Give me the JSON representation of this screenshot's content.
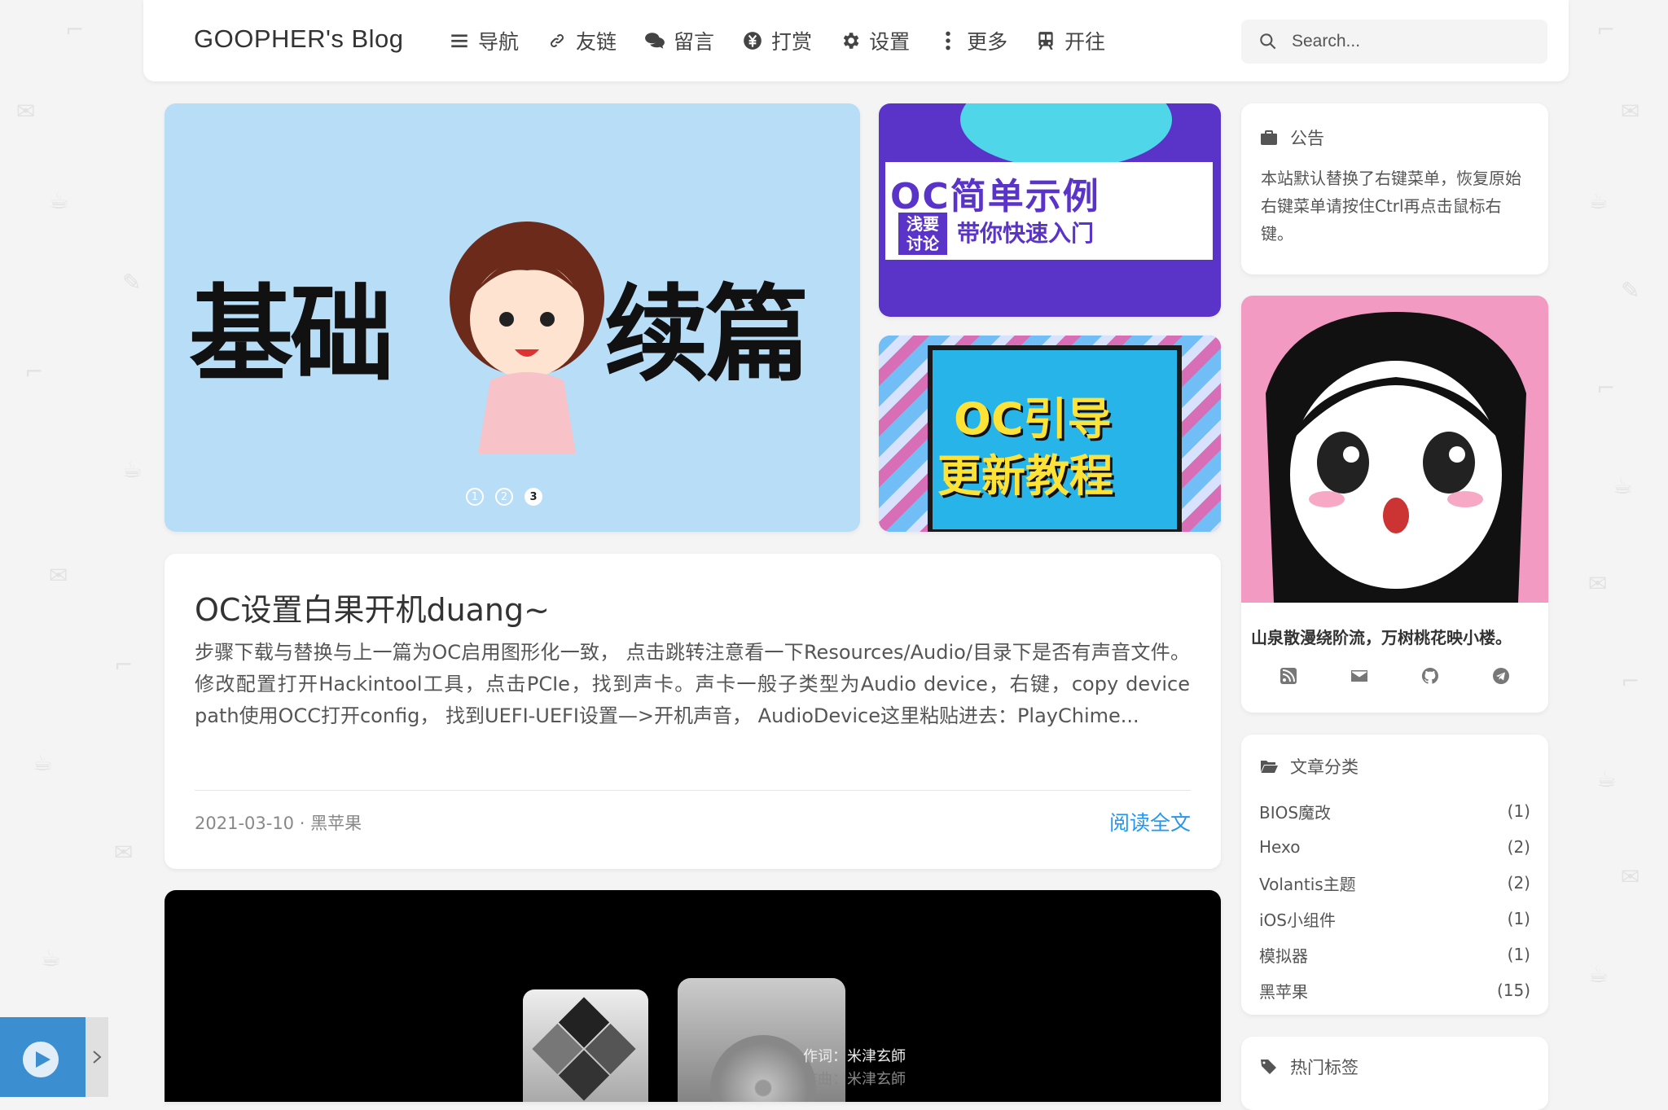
{
  "header": {
    "brand": "GOOPHER's Blog",
    "nav": [
      {
        "label": "导航",
        "icon": "bars-icon"
      },
      {
        "label": "友链",
        "icon": "link-icon"
      },
      {
        "label": "留言",
        "icon": "comments-icon"
      },
      {
        "label": "打赏",
        "icon": "yen-icon"
      },
      {
        "label": "设置",
        "icon": "gear-icon"
      },
      {
        "label": "更多",
        "icon": "ellipsis-vertical-icon"
      },
      {
        "label": "开往",
        "icon": "train-icon"
      }
    ],
    "search_placeholder": "Search..."
  },
  "slider": {
    "left_text": "基础",
    "right_text": "续篇",
    "dots": [
      "1",
      "2",
      "3"
    ],
    "active_dot": 3
  },
  "promo1": {
    "title": "OC简单示例",
    "badge": "浅要讨论",
    "subtitle": "带你快速入门"
  },
  "promo2": {
    "line1": "OC引导",
    "line2": "更新教程"
  },
  "post": {
    "title": "OC设置白果开机duang~",
    "excerpt": "步骤下载与替换与上一篇为OC启用图形化一致， 点击跳转注意看一下Resources/Audio/目录下是否有声音文件。 修改配置打开Hackintool工具，点击PCIe，找到声卡。声卡一般子类型为Audio device，右键，copy device path使用OCC打开config， 找到UEFI-UEFI设置—>开机声音， AudioDevice这里粘贴进去：PlayChime...",
    "date": "2021-03-10",
    "category": "黑苹果",
    "read_more": "阅读全文"
  },
  "video": {
    "lyric1": "作词：米津玄師",
    "lyric2": "作曲：米津玄師"
  },
  "sidebar": {
    "notice_title": "公告",
    "notice_text": "本站默认替换了右键菜单，恢复原始右键菜单请按住Ctrl再点击鼠标右键。",
    "motto": "山泉散漫绕阶流，万树桃花映小楼。",
    "social": [
      "rss-icon",
      "mail-icon",
      "github-icon",
      "telegram-icon"
    ],
    "categories_title": "文章分类",
    "categories": [
      {
        "name": "BIOS魔改",
        "count": "(1)"
      },
      {
        "name": "Hexo",
        "count": "(2)"
      },
      {
        "name": "Volantis主题",
        "count": "(2)"
      },
      {
        "name": "iOS小组件",
        "count": "(1)"
      },
      {
        "name": "模拟器",
        "count": "(1)"
      },
      {
        "name": "黑苹果",
        "count": "(15)"
      }
    ],
    "tags_title": "热门标签"
  },
  "colors": {
    "accent": "#2196f3",
    "slider_bg": "#b8ddf7",
    "promo1_bg": "#5a34c8",
    "profile_bg": "#f39ac2"
  }
}
